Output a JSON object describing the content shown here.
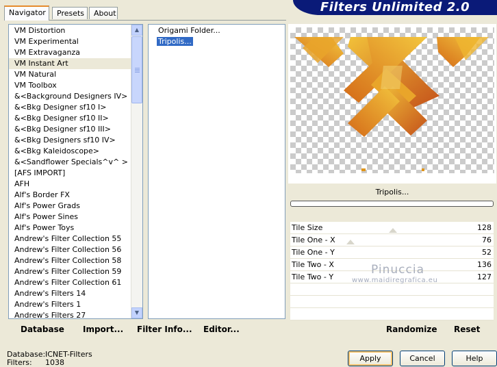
{
  "banner": {
    "title": "Filters Unlimited 2.0"
  },
  "tabs": [
    "Navigator",
    "Presets",
    "About"
  ],
  "categories": [
    "VM Distortion",
    "VM Experimental",
    "VM Extravaganza",
    "VM Instant Art",
    "VM Natural",
    "VM Toolbox",
    "&<Background Designers IV>",
    "&<Bkg Designer sf10 I>",
    "&<Bkg Designer sf10 II>",
    "&<Bkg Designer sf10 III>",
    "&<Bkg Designers sf10 IV>",
    "&<Bkg Kaleidoscope>",
    "&<Sandflower Specials^v^ >",
    "[AFS IMPORT]",
    "AFH",
    "Alf's Border FX",
    "Alf's Power Grads",
    "Alf's Power Sines",
    "Alf's Power Toys",
    "Andrew's Filter Collection 55",
    "Andrew's Filter Collection 56",
    "Andrew's Filter Collection 58",
    "Andrew's Filter Collection 59",
    "Andrew's Filter Collection 61",
    "Andrew's Filters 14",
    "Andrew's Filters 1",
    "Andrew's Filters 27"
  ],
  "selected_category": "VM Instant Art",
  "filters": [
    "Origami Folder...",
    "Tripolis..."
  ],
  "selected_filter": "Tripolis...",
  "preview": {
    "filter_name": "Tripolis..."
  },
  "params": [
    {
      "label": "Tile Size",
      "value": "128"
    },
    {
      "label": "Tile One - X",
      "value": "76"
    },
    {
      "label": "Tile One - Y",
      "value": "52"
    },
    {
      "label": "Tile Two - X",
      "value": "136"
    },
    {
      "label": "Tile Two - Y",
      "value": "127"
    }
  ],
  "watermark": {
    "line1": "Pinuccia",
    "line2": "www.maidiregrafica.eu"
  },
  "toolbar": {
    "database": "Database",
    "import": "Import...",
    "filter_info": "Filter Info...",
    "editor": "Editor..."
  },
  "actions": {
    "randomize": "Randomize",
    "reset": "Reset"
  },
  "status": {
    "database_label": "Database:",
    "database_value": "ICNET-Filters",
    "filters_label": "Filters:",
    "filters_value": "1038"
  },
  "dialog": {
    "apply": "Apply",
    "cancel": "Cancel",
    "help": "Help"
  },
  "colors": {
    "banner": "#0a1a78",
    "selection": "#316ac5",
    "tile_orange": "#e0951a"
  }
}
